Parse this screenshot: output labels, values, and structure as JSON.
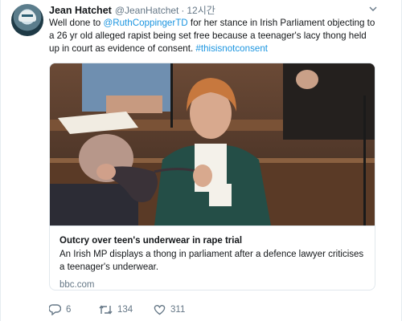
{
  "tweet": {
    "author_name": "Jean Hatchet",
    "author_handle": "@JeanHatchet",
    "separator": "·",
    "timestamp": "12시간",
    "text_prefix": "Well done to ",
    "mention": "@RuthCoppingerTD",
    "text_body": " for her stance in Irish Parliament objecting to a 26 yr old alleged rapist being set free because a teenager's lacy thong held up in court as evidence of consent. ",
    "hashtag": "#thisisnotconsent",
    "link_color": "#1b95e0"
  },
  "card": {
    "title": "Outcry over teen's underwear in rape trial",
    "description": "An Irish MP displays a thong in parliament after a defence lawyer criticises a teenager's underwear.",
    "domain": "bbc.com"
  },
  "actions": {
    "reply_icon": "reply-icon",
    "reply_count": "6",
    "retweet_icon": "retweet-icon",
    "retweet_count": "134",
    "like_icon": "heart-icon",
    "like_count": "311"
  },
  "icons": {
    "menu": "chevron-down-icon"
  }
}
